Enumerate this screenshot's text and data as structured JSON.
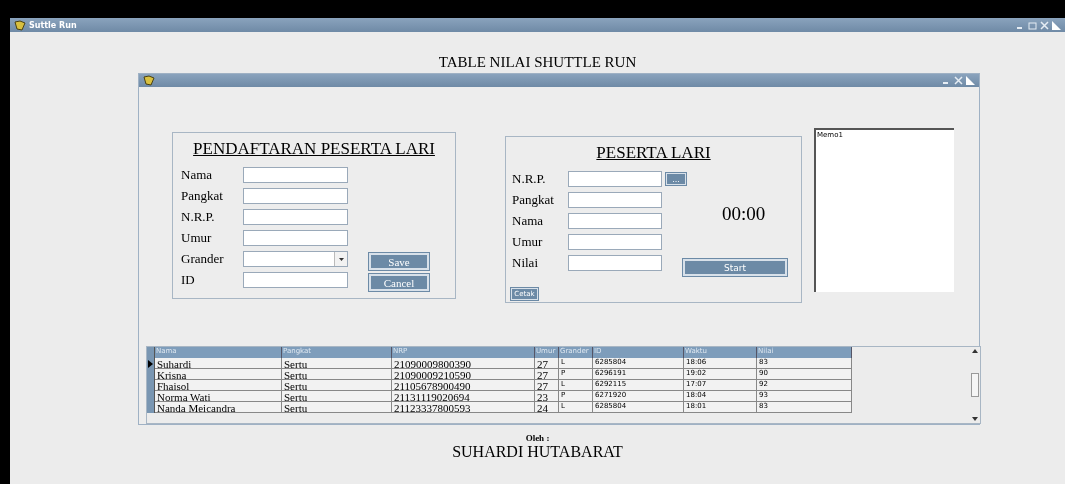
{
  "window": {
    "title": "Suttle Run"
  },
  "heading": "TABLE NILAI SHUTTLE RUN",
  "registration": {
    "title": "PENDAFTARAN PESERTA LARI",
    "fields": [
      {
        "label": "Nama",
        "kind": "text"
      },
      {
        "label": "Pangkat",
        "kind": "text"
      },
      {
        "label": "N.R.P.",
        "kind": "text"
      },
      {
        "label": "Umur",
        "kind": "text"
      },
      {
        "label": "Grander",
        "kind": "dropdown"
      },
      {
        "label": "ID",
        "kind": "text"
      }
    ],
    "buttons": [
      "Save",
      "Cancel"
    ]
  },
  "runner": {
    "title": "PESERTA LARI",
    "fields": [
      {
        "label": "N.R.P.",
        "kind": "lookup",
        "button": "..."
      },
      {
        "label": "Pangkat",
        "kind": "text"
      },
      {
        "label": "Nama",
        "kind": "text"
      },
      {
        "label": "Umur",
        "kind": "text"
      },
      {
        "label": "Nilai",
        "kind": "text"
      }
    ],
    "timer": "00:00",
    "start_button": "Start",
    "print_button": "Cetak"
  },
  "memo": {
    "value": "Memo1"
  },
  "table": {
    "columns": [
      "Nama",
      "Pangkat",
      "NRP",
      "Umur",
      "Grander",
      "ID",
      "Waktu",
      "Nilai"
    ],
    "rows": [
      {
        "selected": true,
        "cells": [
          "Suhardi",
          "Sertu",
          "21090009800390",
          "27",
          "L",
          "6285804",
          "18:06",
          "83"
        ]
      },
      {
        "selected": false,
        "cells": [
          "Krisna",
          "Sertu",
          "21090009210590",
          "27",
          "P",
          "6296191",
          "19:02",
          "90"
        ]
      },
      {
        "selected": false,
        "cells": [
          "Fhaisol",
          "Sertu",
          "21105678900490",
          "27",
          "L",
          "6292115",
          "17:07",
          "92"
        ]
      },
      {
        "selected": false,
        "cells": [
          "Norma Wati",
          "Sertu",
          "21131119020694",
          "23",
          "P",
          "6271920",
          "18:04",
          "93"
        ]
      },
      {
        "selected": false,
        "cells": [
          "Nanda Meicandra",
          "Sertu",
          "21123337800593",
          "24",
          "L",
          "6285804",
          "18:01",
          "83"
        ]
      }
    ]
  },
  "footer": {
    "caption": "Oleh :",
    "author": "SUHARDI HUTABARAT"
  }
}
